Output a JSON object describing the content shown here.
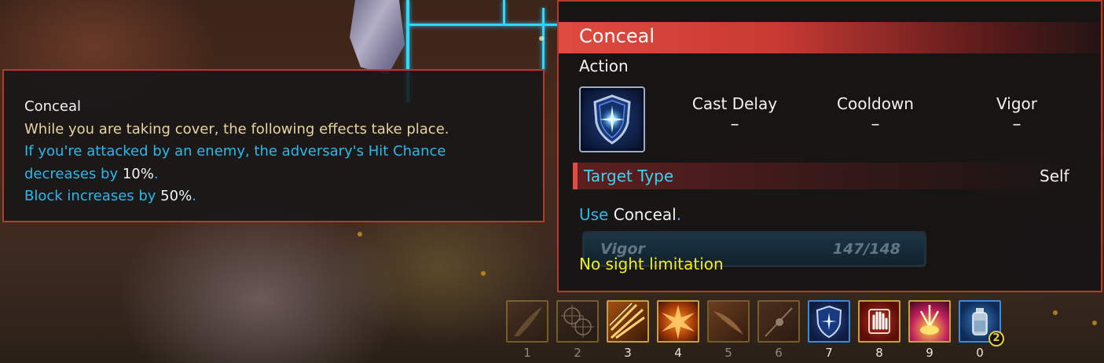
{
  "tooltip": {
    "name": "Conceal",
    "line1": "While you are taking cover, the following effects take place.",
    "line2": "If you're attacked by an enemy, the adversary's Hit Chance",
    "line3_prefix": "decreases by ",
    "line3_value": "10%",
    "line3_suffix": ".",
    "line4_prefix": "Block increases by ",
    "line4_value": "50%",
    "line4_suffix": "."
  },
  "skill": {
    "title": "Conceal",
    "type": "Action",
    "icon": "shield-icon",
    "stats": [
      {
        "label": "Cast Delay",
        "value": "–"
      },
      {
        "label": "Cooldown",
        "value": "–"
      },
      {
        "label": "Vigor",
        "value": "–"
      }
    ],
    "target_label": "Target Type",
    "target_value": "Self",
    "use_word": "Use",
    "use_skill": "Conceal",
    "use_end": ".",
    "resource_name": "Vigor",
    "resource_value": "147/148",
    "range_text": "No sight limitation"
  },
  "hotbar": {
    "slots": [
      {
        "key": "1",
        "icon": "feather-slash-icon",
        "active": false
      },
      {
        "key": "2",
        "icon": "crosshair-icon",
        "active": false
      },
      {
        "key": "3",
        "icon": "bullet-burst-icon",
        "active": true
      },
      {
        "key": "4",
        "icon": "explosion-burst-icon",
        "active": true
      },
      {
        "key": "5",
        "icon": "fire-swipe-icon",
        "active": false
      },
      {
        "key": "6",
        "icon": "spark-shot-icon",
        "active": false
      },
      {
        "key": "7",
        "icon": "shield-icon",
        "active": true
      },
      {
        "key": "8",
        "icon": "hand-stop-icon",
        "active": true
      },
      {
        "key": "9",
        "icon": "burst-up-icon",
        "active": true
      },
      {
        "key": "0",
        "icon": "potion-bottle-icon",
        "active": true,
        "count": "2"
      }
    ]
  },
  "colors": {
    "accent_red": "#e04a40",
    "text_blue": "#2bb8ec",
    "text_gold": "#e8d4a0",
    "text_yellow": "#f4ee18",
    "slot_gold": "#c8a040"
  }
}
